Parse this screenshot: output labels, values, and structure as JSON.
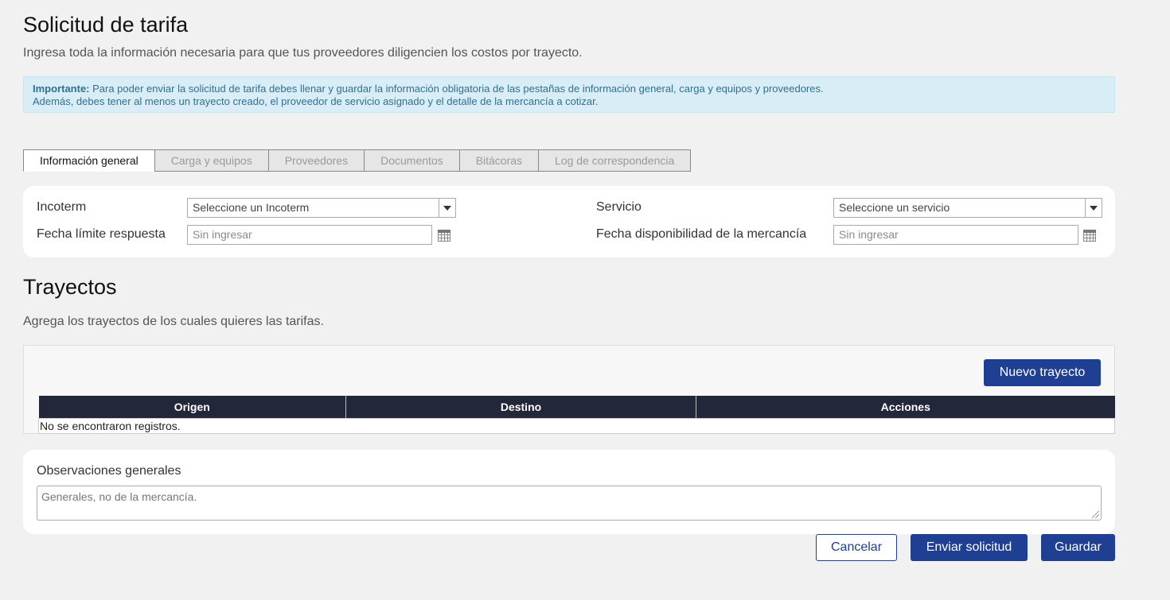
{
  "header": {
    "title": "Solicitud de tarifa",
    "subtitle": "Ingresa toda la información necesaria para que tus proveedores diligencien los costos por trayecto."
  },
  "alert": {
    "label": "Importante:",
    "line1": " Para poder enviar la solicitud de tarifa debes llenar y guardar la información obligatoria de las pestañas de información general, carga y equipos y proveedores.",
    "line2": "Además, debes tener al menos un trayecto creado, el proveedor de servicio asignado y el detalle de la mercancía a cotizar."
  },
  "tabs": [
    {
      "label": "Información general",
      "active": true
    },
    {
      "label": "Carga y equipos",
      "active": false
    },
    {
      "label": "Proveedores",
      "active": false
    },
    {
      "label": "Documentos",
      "active": false
    },
    {
      "label": "Bitácoras",
      "active": false
    },
    {
      "label": "Log de correspondencia",
      "active": false
    }
  ],
  "general": {
    "incoterm_label": "Incoterm",
    "incoterm_value": "Seleccione un Incoterm",
    "servicio_label": "Servicio",
    "servicio_value": "Seleccione un servicio",
    "fecha_limite_label": "Fecha límite respuesta",
    "fecha_limite_placeholder": "Sin ingresar",
    "fecha_disp_label": "Fecha disponibilidad de la mercancía",
    "fecha_disp_placeholder": "Sin ingresar"
  },
  "trayectos": {
    "title": "Trayectos",
    "subtitle": "Agrega los trayectos de los cuales quieres las tarifas.",
    "new_button": "Nuevo trayecto",
    "columns": [
      "Origen",
      "Destino",
      "Acciones"
    ],
    "empty_text": "No se encontraron registros."
  },
  "observaciones": {
    "label": "Observaciones generales",
    "placeholder": "Generales, no de la mercancía."
  },
  "actions": {
    "cancel": "Cancelar",
    "send": "Enviar solicitud",
    "save": "Guardar"
  },
  "colors": {
    "primary": "#1f3f93",
    "table_header": "#23273a",
    "alert_bg": "#d9edf7",
    "alert_text": "#31708f"
  }
}
